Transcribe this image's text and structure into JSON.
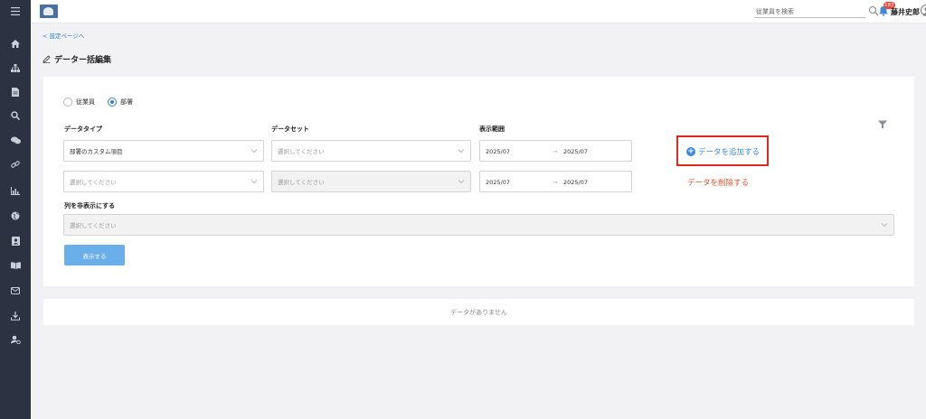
{
  "colors": {
    "sidebar": "#2b3241",
    "accent": "#2f7fd8",
    "danger": "#e84b3c",
    "highlight": "#e5261f"
  },
  "sidebar": {
    "items": [
      {
        "icon": "menu-icon"
      },
      {
        "icon": "home-icon"
      },
      {
        "icon": "org-chart-icon"
      },
      {
        "icon": "document-icon"
      },
      {
        "icon": "search-icon"
      },
      {
        "icon": "chat-icon"
      },
      {
        "icon": "link-icon"
      },
      {
        "icon": "chart-icon"
      },
      {
        "icon": "globe-icon"
      },
      {
        "icon": "person-card-icon"
      },
      {
        "icon": "book-icon"
      },
      {
        "icon": "mail-icon"
      },
      {
        "icon": "download-icon"
      },
      {
        "icon": "user-settings-icon"
      }
    ]
  },
  "header": {
    "search_placeholder": "従業員を検索",
    "notification_count": "183",
    "user_name": "藤井史郎",
    "help_label": "?"
  },
  "nav": {
    "back_link": "< 設定ページへ"
  },
  "page": {
    "title": "データー括編集"
  },
  "form": {
    "radio_employee": "従業員",
    "radio_department": "部署",
    "selected_radio": "部署",
    "label_data_type": "データタイプ",
    "label_dataset": "データセット",
    "label_display_range": "表示範囲",
    "rows": [
      {
        "data_type": "部署のカスタム項目",
        "dataset": "選択してください",
        "range_from": "2025/07",
        "range_to": "2025/07"
      },
      {
        "data_type": "選択してください",
        "dataset": "選択してください",
        "range_from": "2025/07",
        "range_to": "2025/07"
      }
    ],
    "range_arrow": "→",
    "add_data": "データを追加する",
    "delete_data": "データを削除する",
    "label_hide_columns": "列を非表示にする",
    "hide_columns_placeholder": "選択してください",
    "submit": "表示する"
  },
  "result": {
    "empty_message": "データがありません"
  }
}
